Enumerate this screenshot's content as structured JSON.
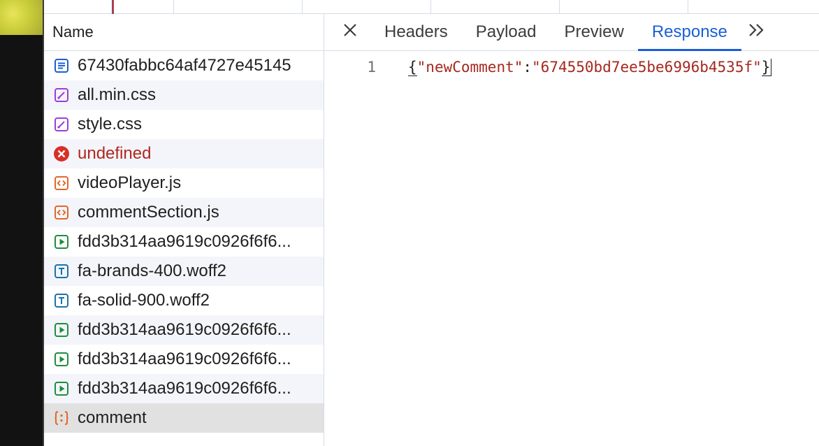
{
  "colors": {
    "accent": "#1a5fd6",
    "error": "#b3261e",
    "json_string": "#a5281e",
    "selected_row": "#e0e1e0"
  },
  "name_column": {
    "header": "Name",
    "requests": [
      {
        "label": "67430fabbc64af4727e45145",
        "icon": "document-icon"
      },
      {
        "label": "all.min.css",
        "icon": "stylesheet-icon"
      },
      {
        "label": "style.css",
        "icon": "stylesheet-icon"
      },
      {
        "label": "undefined",
        "icon": "error-icon"
      },
      {
        "label": "videoPlayer.js",
        "icon": "script-icon"
      },
      {
        "label": "commentSection.js",
        "icon": "script-icon"
      },
      {
        "label": "fdd3b314aa9619c0926f6f6...",
        "icon": "media-icon"
      },
      {
        "label": "fa-brands-400.woff2",
        "icon": "font-icon"
      },
      {
        "label": "fa-solid-900.woff2",
        "icon": "font-icon"
      },
      {
        "label": "fdd3b314aa9619c0926f6f6...",
        "icon": "media-icon"
      },
      {
        "label": "fdd3b314aa9619c0926f6f6...",
        "icon": "media-icon"
      },
      {
        "label": "fdd3b314aa9619c0926f6f6...",
        "icon": "media-icon"
      },
      {
        "label": "comment",
        "icon": "fetch-icon",
        "selected": true
      }
    ]
  },
  "details": {
    "tabs": {
      "headers": "Headers",
      "payload": "Payload",
      "preview": "Preview",
      "response": "Response"
    },
    "active_tab": "Response",
    "response": {
      "line_number": "1",
      "open_brace": "{",
      "key": "\"newComment\"",
      "colon": ":",
      "value": "\"674550bd7ee5be6996b4535f\"",
      "close_brace": "}"
    }
  }
}
